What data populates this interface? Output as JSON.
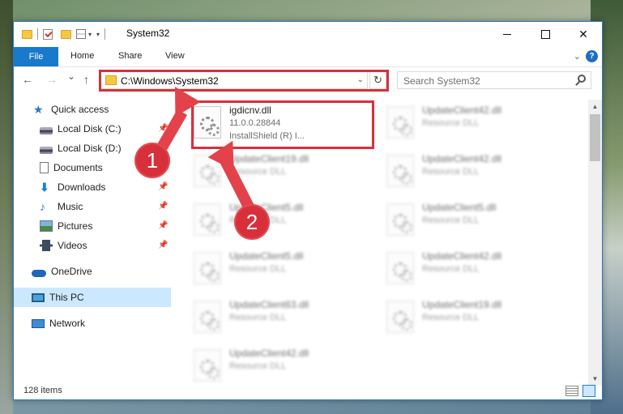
{
  "window": {
    "title": "System32",
    "close_glyph": "✕"
  },
  "ribbon": {
    "file": "File",
    "tabs": [
      "Home",
      "Share",
      "View"
    ],
    "help": "?"
  },
  "nav": {
    "back": "←",
    "forward": "→",
    "recent": "⌄",
    "up": "↑",
    "address": "C:\\Windows\\System32",
    "refresh": "↻",
    "search_placeholder": "Search System32"
  },
  "sidebar": {
    "items": [
      {
        "label": "Quick access",
        "icon": "star-icon"
      },
      {
        "label": "Local Disk (C:)",
        "icon": "disk-icon"
      },
      {
        "label": "Local Disk (D:)",
        "icon": "disk-icon"
      },
      {
        "label": "Documents",
        "icon": "document-icon"
      },
      {
        "label": "Downloads",
        "icon": "download-icon"
      },
      {
        "label": "Music",
        "icon": "music-icon"
      },
      {
        "label": "Pictures",
        "icon": "pictures-icon"
      },
      {
        "label": "Videos",
        "icon": "videos-icon"
      },
      {
        "label": "OneDrive",
        "icon": "cloud-icon"
      },
      {
        "label": "This PC",
        "icon": "computer-icon"
      },
      {
        "label": "Network",
        "icon": "network-icon"
      }
    ]
  },
  "files": [
    {
      "name": "igdicnv.dll",
      "line2": "11.0.0.28844",
      "line3": "InstallShield (R) I..."
    },
    {
      "name": "UpdateClient42.dll",
      "line2": "Resource DLL"
    },
    {
      "name": "UpdateClient19.dll",
      "line2": "Resource DLL"
    },
    {
      "name": "UpdateClient42.dll",
      "line2": "Resource DLL"
    },
    {
      "name": "UpdateClient5.dll",
      "line2": "Resource DLL"
    },
    {
      "name": "UpdateClient5.dll",
      "line2": "Resource DLL"
    },
    {
      "name": "UpdateClient5.dll",
      "line2": "Resource DLL"
    },
    {
      "name": "UpdateClient42.dll",
      "line2": "Resource DLL"
    },
    {
      "name": "UpdateClient63.dll",
      "line2": "Resource DLL"
    },
    {
      "name": "UpdateClient19.dll",
      "line2": "Resource DLL"
    },
    {
      "name": "UpdateClient42.dll",
      "line2": "Resource DLL"
    }
  ],
  "status": {
    "items": "128 items"
  },
  "annotations": {
    "badge1": "1",
    "badge2": "2",
    "color": "#d8303a"
  }
}
